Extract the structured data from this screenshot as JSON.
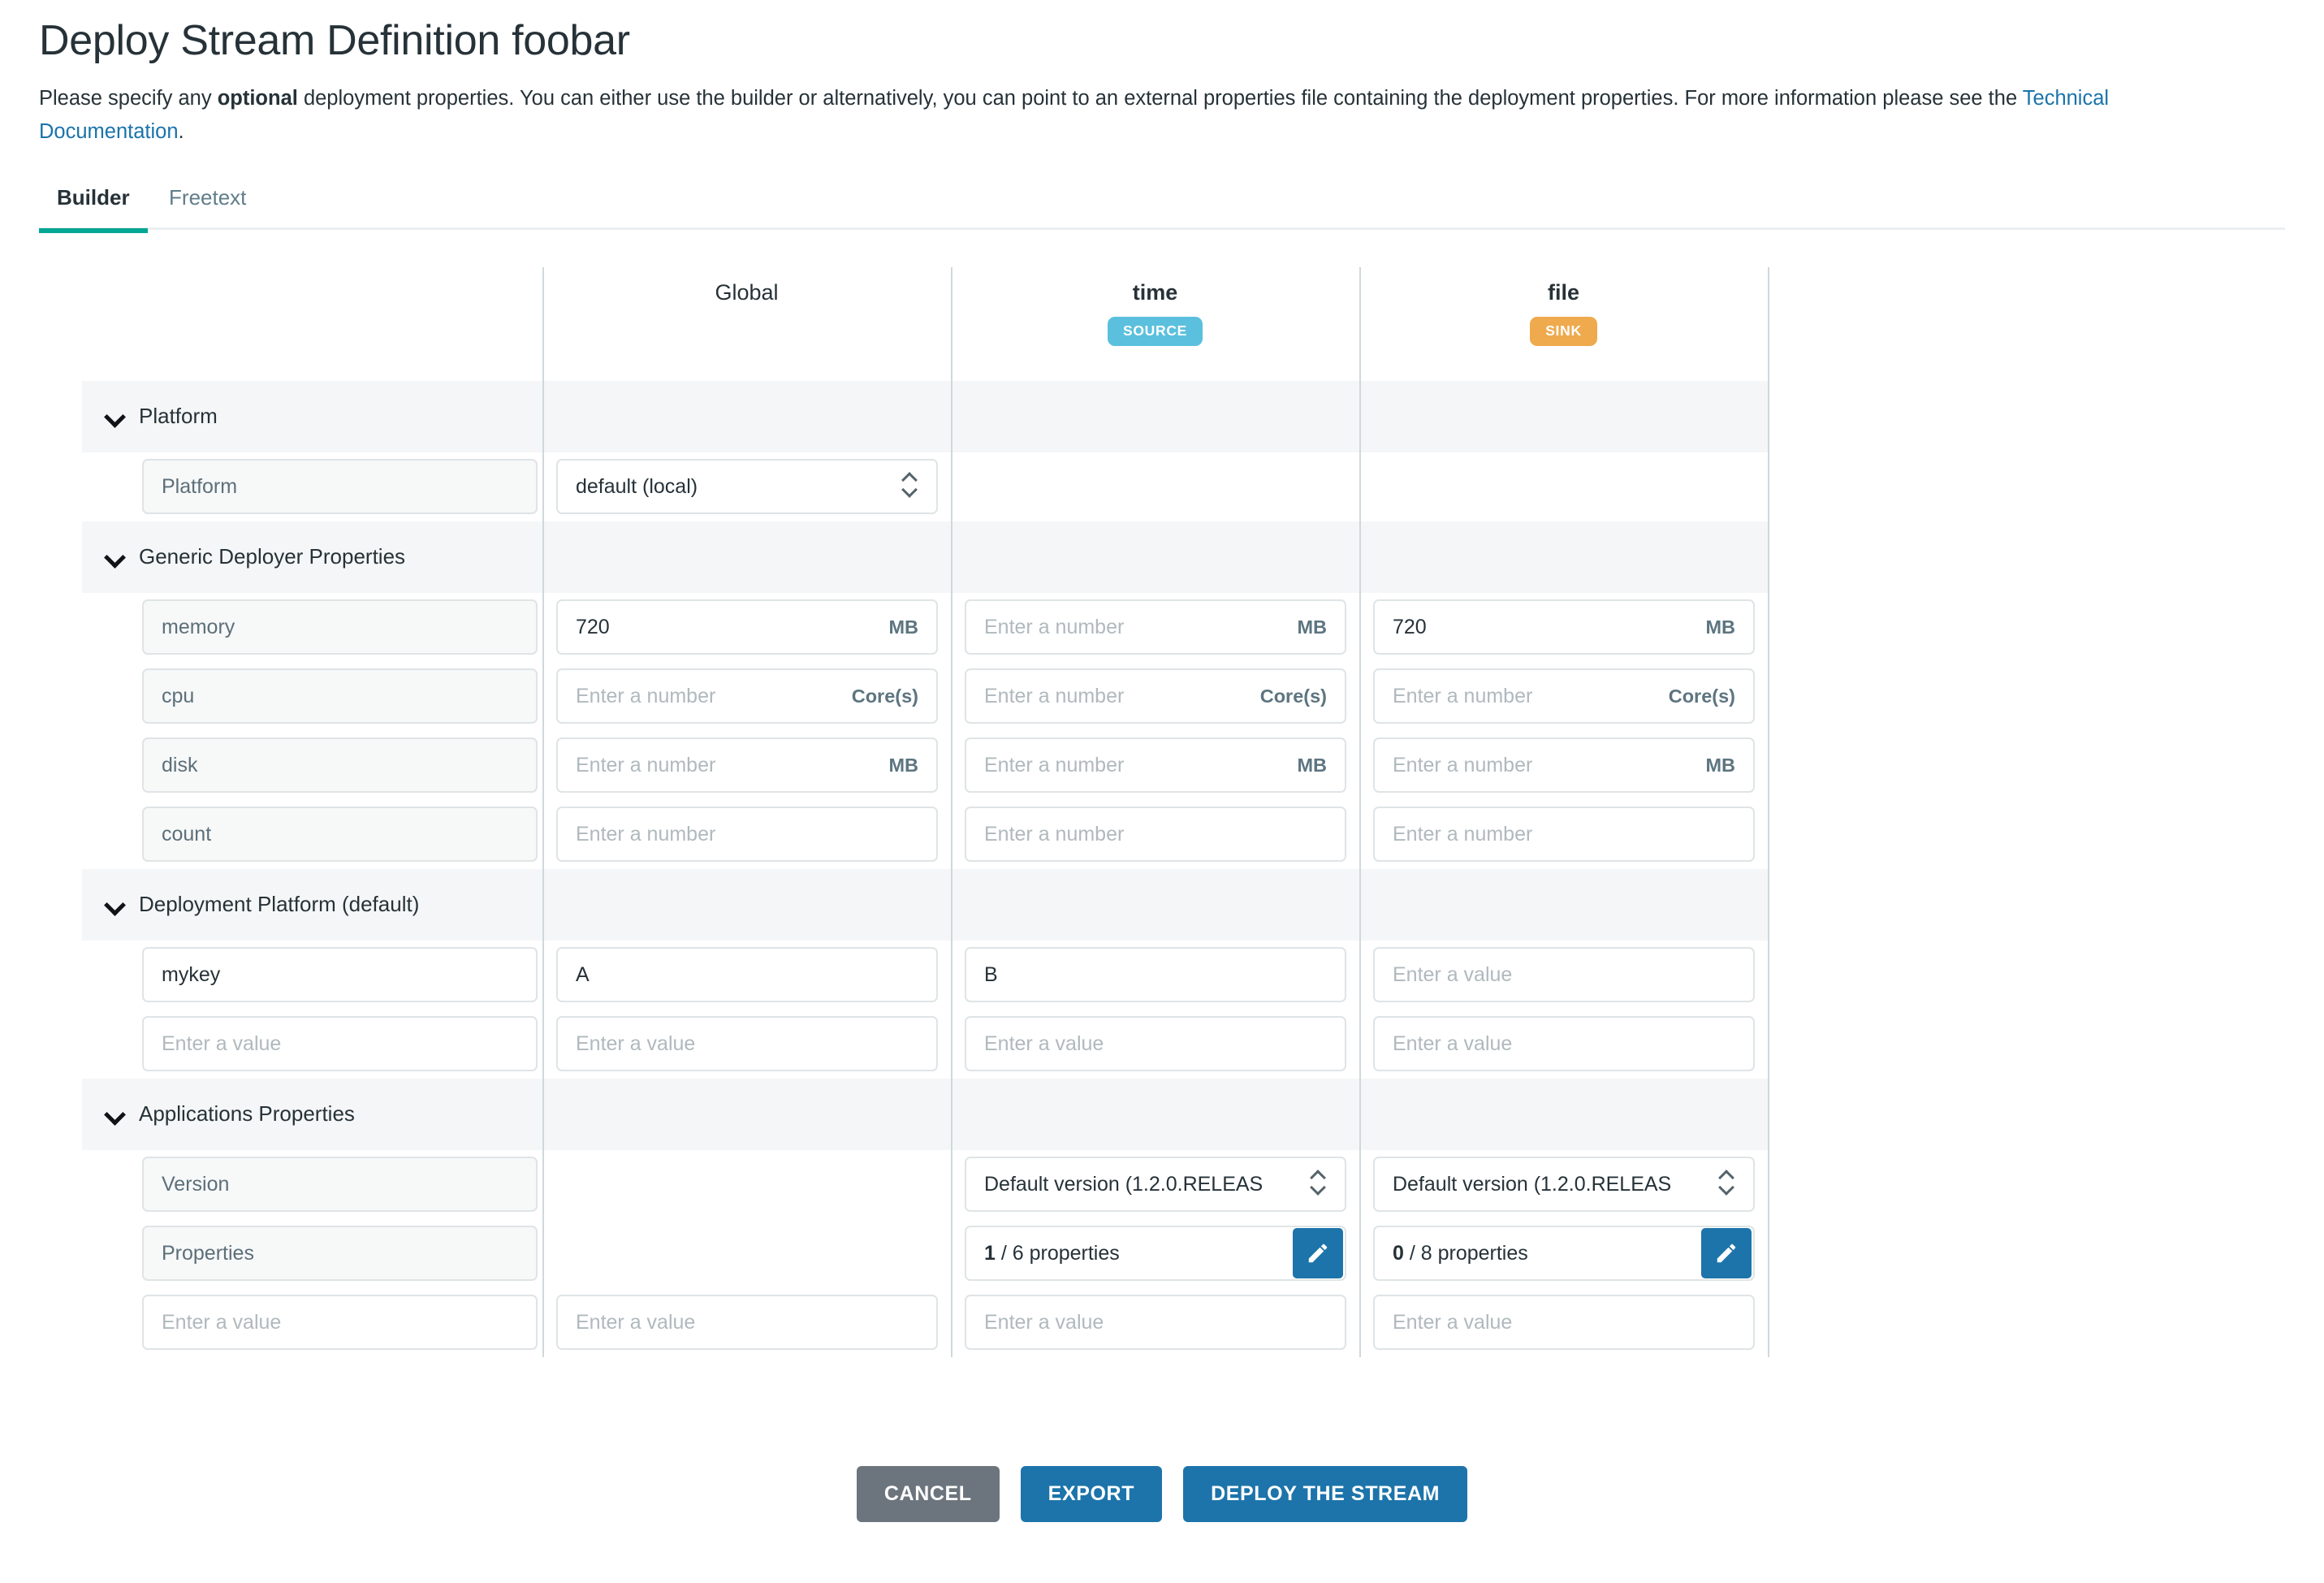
{
  "header": {
    "title": "Deploy Stream Definition foobar",
    "desc_part1": "Please specify any ",
    "desc_bold": "optional",
    "desc_part2": " deployment properties. You can either use the builder or alternatively, you can point to an external properties file containing the deployment properties. For more information please see the ",
    "desc_link": "Technical Documentation",
    "desc_part3": "."
  },
  "tabs": [
    {
      "label": "Builder",
      "active": true
    },
    {
      "label": "Freetext",
      "active": false
    }
  ],
  "table": {
    "columns": [
      {
        "key": "name",
        "title": "",
        "badge": null
      },
      {
        "key": "global",
        "title": "Global",
        "badge": null,
        "bold": false
      },
      {
        "key": "time",
        "title": "time",
        "badge": "SOURCE",
        "badge_color": "#5bc0de",
        "bold": true
      },
      {
        "key": "file",
        "title": "file",
        "badge": "SINK",
        "badge_color": "#eeaa4d",
        "bold": true
      }
    ],
    "placeholders": {
      "number": "Enter a number",
      "value": "Enter a value"
    },
    "groups": [
      {
        "label": "Platform",
        "rows": [
          {
            "name": "Platform",
            "name_readonly": true,
            "global": {
              "type": "select",
              "value": "default (local)"
            },
            "time": {
              "type": "none"
            },
            "file": {
              "type": "none"
            }
          }
        ]
      },
      {
        "label": "Generic Deployer Properties",
        "rows": [
          {
            "name": "memory",
            "name_readonly": true,
            "global": {
              "type": "number",
              "value": "720",
              "unit": "MB"
            },
            "time": {
              "type": "number",
              "value": "",
              "unit": "MB"
            },
            "file": {
              "type": "number",
              "value": "720",
              "unit": "MB"
            }
          },
          {
            "name": "cpu",
            "name_readonly": true,
            "global": {
              "type": "number",
              "value": "",
              "unit": "Core(s)"
            },
            "time": {
              "type": "number",
              "value": "",
              "unit": "Core(s)"
            },
            "file": {
              "type": "number",
              "value": "",
              "unit": "Core(s)"
            }
          },
          {
            "name": "disk",
            "name_readonly": true,
            "global": {
              "type": "number",
              "value": "",
              "unit": "MB"
            },
            "time": {
              "type": "number",
              "value": "",
              "unit": "MB"
            },
            "file": {
              "type": "number",
              "value": "",
              "unit": "MB"
            }
          },
          {
            "name": "count",
            "name_readonly": true,
            "global": {
              "type": "number",
              "value": "",
              "unit": ""
            },
            "time": {
              "type": "number",
              "value": "",
              "unit": ""
            },
            "file": {
              "type": "number",
              "value": "",
              "unit": ""
            }
          }
        ]
      },
      {
        "label": "Deployment Platform (default)",
        "rows": [
          {
            "name": "mykey",
            "name_readonly": false,
            "global": {
              "type": "text",
              "value": "A"
            },
            "time": {
              "type": "text",
              "value": "B"
            },
            "file": {
              "type": "text",
              "value": ""
            }
          },
          {
            "name": "",
            "name_readonly": false,
            "global": {
              "type": "text",
              "value": ""
            },
            "time": {
              "type": "text",
              "value": ""
            },
            "file": {
              "type": "text",
              "value": ""
            }
          }
        ]
      },
      {
        "label": "Applications Properties",
        "rows": [
          {
            "name": "Version",
            "name_readonly": true,
            "global": {
              "type": "none"
            },
            "time": {
              "type": "select",
              "value": "Default version (1.2.0.RELEAS"
            },
            "file": {
              "type": "select",
              "value": "Default version (1.2.0.RELEAS"
            }
          },
          {
            "name": "Properties",
            "name_readonly": true,
            "global": {
              "type": "none"
            },
            "time": {
              "type": "properties",
              "count": "1",
              "total_text": "/ 6 properties"
            },
            "file": {
              "type": "properties",
              "count": "0",
              "total_text": "/ 8 properties"
            }
          },
          {
            "name": "",
            "name_readonly": false,
            "global": {
              "type": "text",
              "value": ""
            },
            "time": {
              "type": "text",
              "value": ""
            },
            "file": {
              "type": "text",
              "value": ""
            }
          }
        ]
      }
    ]
  },
  "actions": [
    {
      "label": "CANCEL",
      "style": "cancel",
      "name": "cancel-button"
    },
    {
      "label": "EXPORT",
      "style": "primary",
      "name": "export-button"
    },
    {
      "label": "DEPLOY THE STREAM",
      "style": "primary",
      "name": "deploy-the-stream-button"
    }
  ],
  "colors": {
    "accent_teal": "#00a794",
    "link_blue": "#1a73ab",
    "primary_blue": "#1c74aa",
    "cancel_gray": "#6c757d",
    "source_badge": "#5bc0de",
    "sink_badge": "#eeaa4d"
  }
}
